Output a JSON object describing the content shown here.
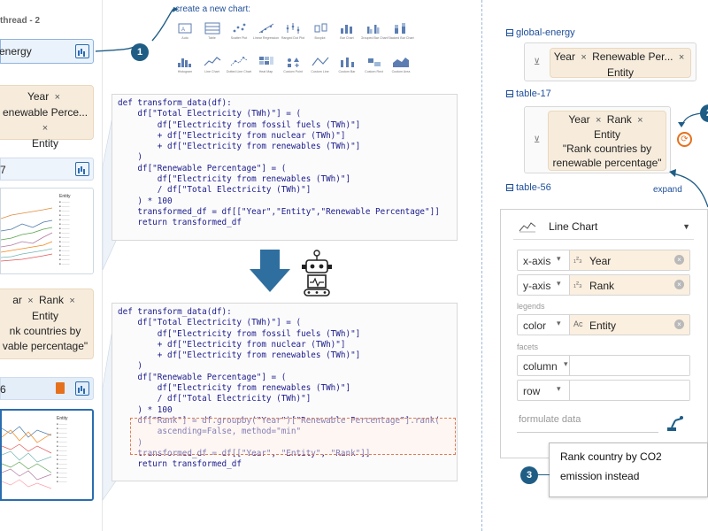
{
  "thread": {
    "title": "thread - 2",
    "source_label": "energy",
    "pill1": {
      "a": "Year",
      "b": "enewable Perce...",
      "c": "Entity"
    },
    "tile_number": "7",
    "pill2": {
      "a": "ar",
      "b": "Rank",
      "c": "Entity",
      "d": "nk countries by",
      "e": "vable percentage\""
    },
    "tile2_number": "6",
    "legend_title": "Entity"
  },
  "picker": {
    "title": "create a new chart:",
    "row1": [
      "Auto",
      "Table",
      "Scatter Plot",
      "Linear Regression",
      "Ranged Dot Plot",
      "Boxplot",
      "Bar Chart",
      "Grouped Bar Chart",
      "Stacked Bar Chart"
    ],
    "row2": [
      "Histogram",
      "Line Chart",
      "Dotted Line Chart",
      "Heat Map",
      "Custom Point",
      "Custom Line",
      "Custom Bar",
      "Custom Rect",
      "Custom Area"
    ]
  },
  "annotations": {
    "b1": "1",
    "b2": "2",
    "b3": "3",
    "expand": "expand"
  },
  "code1": [
    "def transform_data(df):",
    "    df[\"Total Electricity (TWh)\"] = (",
    "        df[\"Electricity from fossil fuels (TWh)\"]",
    "        + df[\"Electricity from nuclear (TWh)\"]",
    "        + df[\"Electricity from renewables (TWh)\"]",
    "    )",
    "    df[\"Renewable Percentage\"] = (",
    "        df[\"Electricity from renewables (TWh)\"]",
    "        / df[\"Total Electricity (TWh)\"]",
    "    ) * 100",
    "    transformed_df = df[[\"Year\",\"Entity\",\"Renewable Percentage\"]]",
    "    return transformed_df"
  ],
  "code2": [
    "def transform_data(df):",
    "    df[\"Total Electricity (TWh)\"] = (",
    "        df[\"Electricity from fossil fuels (TWh)\"]",
    "        + df[\"Electricity from nuclear (TWh)\"]",
    "        + df[\"Electricity from renewables (TWh)\"]",
    "    )",
    "    df[\"Renewable Percentage\"] = (",
    "        df[\"Electricity from renewables (TWh)\"]",
    "        / df[\"Total Electricity (TWh)\"]",
    "    ) * 100",
    "    df[\"Rank\"] = df.groupby(\"Year\")[\"Renewable Percentage\"].rank(",
    "        ascending=False, method=\"min\"",
    "    )",
    "    transformed_df = df[[\"Year\", \"Entity\", \"Rank\"]]",
    "    return transformed_df"
  ],
  "right": {
    "t1_label": "global-energy",
    "t1_pill": {
      "a": "Year",
      "b": "Renewable Per...",
      "c": "Entity"
    },
    "t2_label": "table-17",
    "t2_pill": {
      "a": "Year",
      "b": "Rank",
      "c": "Entity",
      "d": "\"Rank countries by",
      "e": "renewable percentage\""
    },
    "t3_label": "table-56",
    "chart_type": "Line Chart",
    "encodings": {
      "x": {
        "channel": "x-axis",
        "field": "Year"
      },
      "y": {
        "channel": "y-axis",
        "field": "Rank"
      },
      "legends_label": "legends",
      "color": {
        "channel": "color",
        "field": "Entity"
      },
      "facets_label": "facets",
      "column": {
        "channel": "column",
        "field": ""
      },
      "row": {
        "channel": "row",
        "field": ""
      }
    },
    "formulate_placeholder": "formulate data",
    "prompt_text": "Rank country by CO2 emission instead"
  },
  "colors": {
    "accent": "#1f5d85",
    "pill_bg": "#f7ecdc",
    "highlight": "#e07b54"
  }
}
